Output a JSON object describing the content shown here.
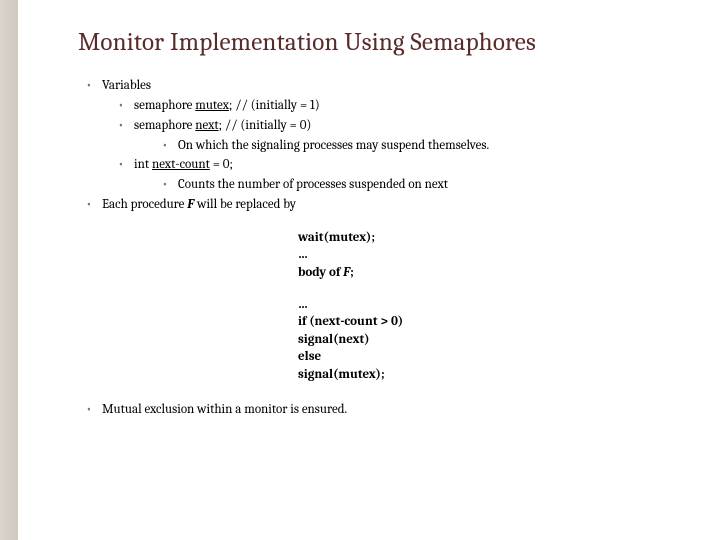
{
  "title": "Monitor Implementation Using Semaphores",
  "bullets": {
    "variables": "Variables",
    "mutex_pre": "semaphore ",
    "mutex_u": "mutex",
    "mutex_post": ";  // (initially  = 1)",
    "next_pre": "semaphore ",
    "next_u": "next",
    "next_post": ";     // (initially  = 0)",
    "next_desc": "On which the signaling processes may suspend themselves.",
    "nextcount_pre": "int ",
    "nextcount_u": "next-count",
    "nextcount_post": " = 0;",
    "nextcount_desc": "Counts the number of processes suspended on next",
    "eachproc_pre": "Each procedure ",
    "eachproc_f": "F",
    "eachproc_post": "  will be replaced by"
  },
  "code1": {
    "l1": "wait(mutex);",
    "l2": "   …",
    "l3_pre": "     body of ",
    "l3_f": "F",
    "l3_post": ";"
  },
  "code2": {
    "l1": "   …",
    "l2": "if (next-count > 0)",
    "l3": "    signal(next)",
    "l4": "else",
    "l5": "    signal(mutex);"
  },
  "final": "Mutual exclusion within a monitor is ensured."
}
